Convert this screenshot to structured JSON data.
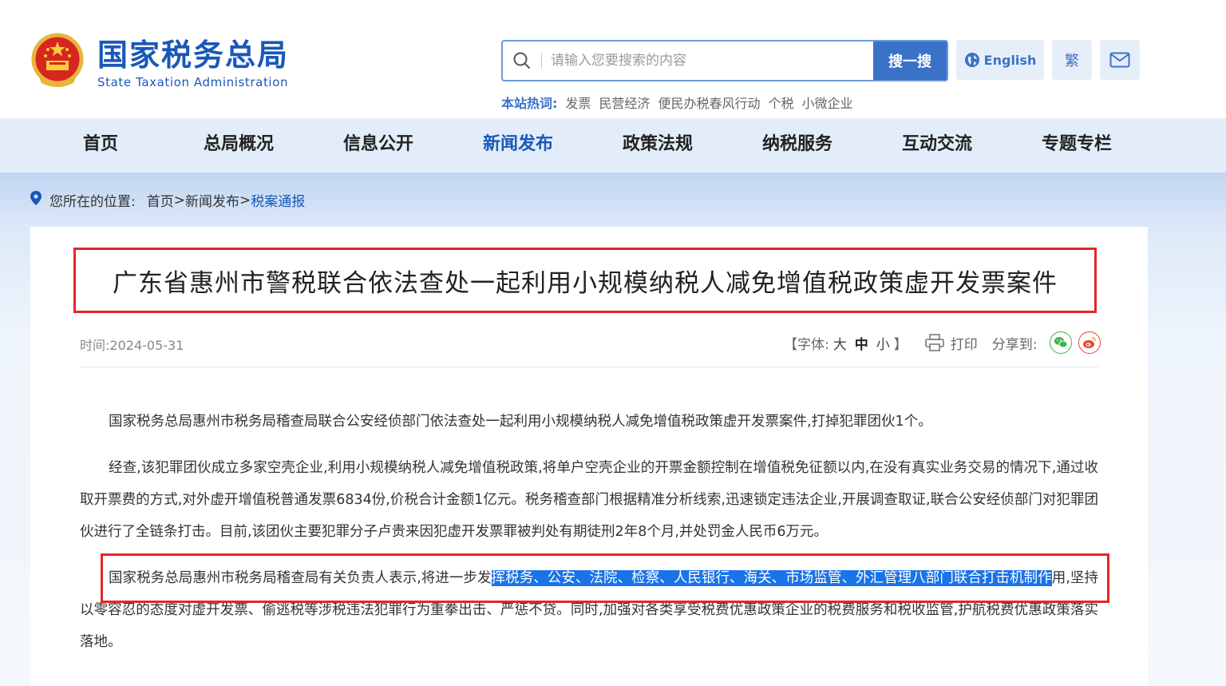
{
  "header": {
    "logo_cn": "国家税务总局",
    "logo_en": "State Taxation Administration",
    "search_placeholder": "请输入您要搜索的内容",
    "search_button": "搜一搜",
    "english_label": "English",
    "traditional_label": "繁",
    "hotwords_label": "本站热词:",
    "hotwords": [
      "发票",
      "民营经济",
      "便民办税春风行动",
      "个税",
      "小微企业"
    ]
  },
  "nav": {
    "items": [
      {
        "label": "首页",
        "active": false
      },
      {
        "label": "总局概况",
        "active": false
      },
      {
        "label": "信息公开",
        "active": false
      },
      {
        "label": "新闻发布",
        "active": true
      },
      {
        "label": "政策法规",
        "active": false
      },
      {
        "label": "纳税服务",
        "active": false
      },
      {
        "label": "互动交流",
        "active": false
      },
      {
        "label": "专题专栏",
        "active": false
      }
    ]
  },
  "breadcrumb": {
    "prefix": "您所在的位置:",
    "home": "首页",
    "section": "新闻发布",
    "current": "税案通报",
    "separator": ">"
  },
  "article": {
    "title": "广东省惠州市警税联合依法查处一起利用小规模纳税人减免增值税政策虚开发票案件",
    "time_label": "时间:",
    "date": "2024-05-31",
    "font_label_open": "【字体:",
    "font_large": "大",
    "font_medium": "中",
    "font_small": "小",
    "font_label_close": "】",
    "print_label": "打印",
    "share_label": "分享到:",
    "p1": "国家税务总局惠州市税务局稽查局联合公安经侦部门依法查处一起利用小规模纳税人减免增值税政策虚开发票案件,打掉犯罪团伙1个。",
    "p2": "经查,该犯罪团伙成立多家空壳企业,利用小规模纳税人减免增值税政策,将单户空壳企业的开票金额控制在增值税免征额以内,在没有真实业务交易的情况下,通过收取开票费的方式,对外虚开增值税普通发票6834份,价税合计金额1亿元。税务稽查部门根据精准分析线索,迅速锁定违法企业,开展调查取证,联合公安经侦部门对犯罪团伙进行了全链条打击。目前,该团伙主要犯罪分子卢贵来因犯虚开发票罪被判处有期徒刑2年8个月,并处罚金人民币6万元。",
    "p3_before": "国家税务总局惠州市税务局稽查局有关负责人表示,将进一步发",
    "p3_highlight": "挥税务、公安、法院、检察、人民银行、海关、市场监管、外汇管理八部门联合打击机制作",
    "p3_after": "用,坚持以零容忍的态度对虚开发票、偷逃税等涉税违法犯罪行为重拳出击、严惩不贷。同时,加强对各类享受税费优惠政策企业的税费服务和税收监管,护航税费优惠政策落实落地。"
  },
  "colors": {
    "brand_blue": "#1a58b8",
    "highlight": "#1a73e8",
    "annotation_red": "#e2262a"
  }
}
